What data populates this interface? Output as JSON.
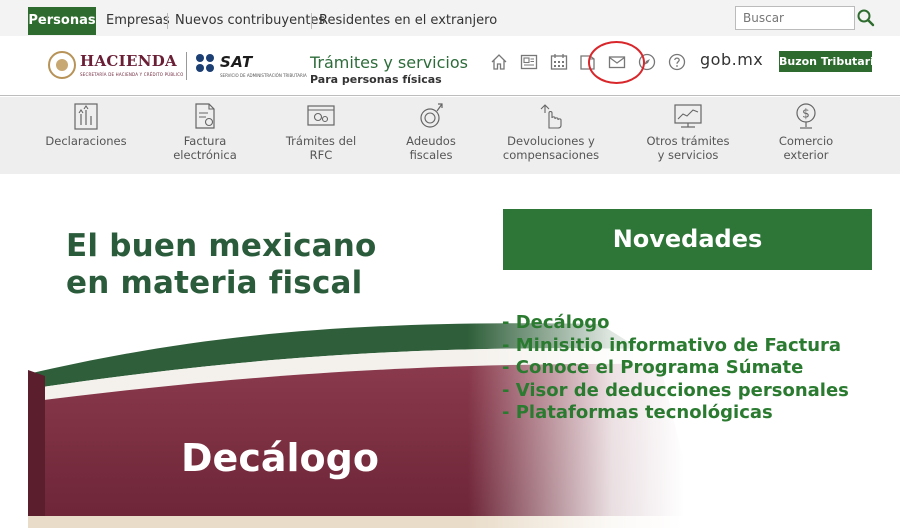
{
  "topbar": {
    "tabs": [
      "Personas",
      "Empresas",
      "Nuevos contribuyentes",
      "Residentes en el extranjero"
    ],
    "search_placeholder": "Buscar"
  },
  "header": {
    "hacienda_logo_text": "HACIENDA",
    "hacienda_logo_subtext": "SECRETARÍA DE HACIENDA Y CRÉDITO PÚBLICO",
    "sat_logo_text": "SAT",
    "sat_logo_subtext": "SERVICIO DE ADMINISTRACIÓN TRIBUTARIA",
    "title": "Trámites y servicios",
    "subtitle": "Para personas físicas",
    "icons": [
      "home-icon",
      "newspaper-icon",
      "calendar-icon",
      "book-icon",
      "mail-icon",
      "compass-icon",
      "help-icon"
    ],
    "gob_label": "gob.mx",
    "buzon_label": "Buzon Tributario"
  },
  "services": [
    {
      "label1": "Declaraciones",
      "label2": "",
      "icon": "declaraciones-icon"
    },
    {
      "label1": "Factura",
      "label2": "electrónica",
      "icon": "factura-icon"
    },
    {
      "label1": "Trámites del",
      "label2": "RFC",
      "icon": "rfc-icon"
    },
    {
      "label1": "Adeudos",
      "label2": "fiscales",
      "icon": "adeudos-icon"
    },
    {
      "label1": "Devoluciones y",
      "label2": "compensaciones",
      "icon": "devoluciones-icon"
    },
    {
      "label1": "Otros trámites",
      "label2": "y servicios",
      "icon": "otros-tramites-icon"
    },
    {
      "label1": "Comercio",
      "label2": "exterior",
      "icon": "comercio-exterior-icon"
    }
  ],
  "banner": {
    "headline_line1": "El buen mexicano",
    "headline_line2": "en materia fiscal",
    "ribbon_title": "Decálogo",
    "novedades_title": "Novedades",
    "novedades_items": [
      "- Decálogo",
      "- Minisitio informativo de Factura",
      "- Conoce el Programa Súmate",
      "- Visor de deducciones personales",
      "- Plataformas tecnológicas"
    ]
  },
  "colors": {
    "primary_green": "#2e6b2e",
    "novedades_green": "#2e7538",
    "guinda": "#7a2b3e",
    "annotation_red": "#d8262b"
  }
}
